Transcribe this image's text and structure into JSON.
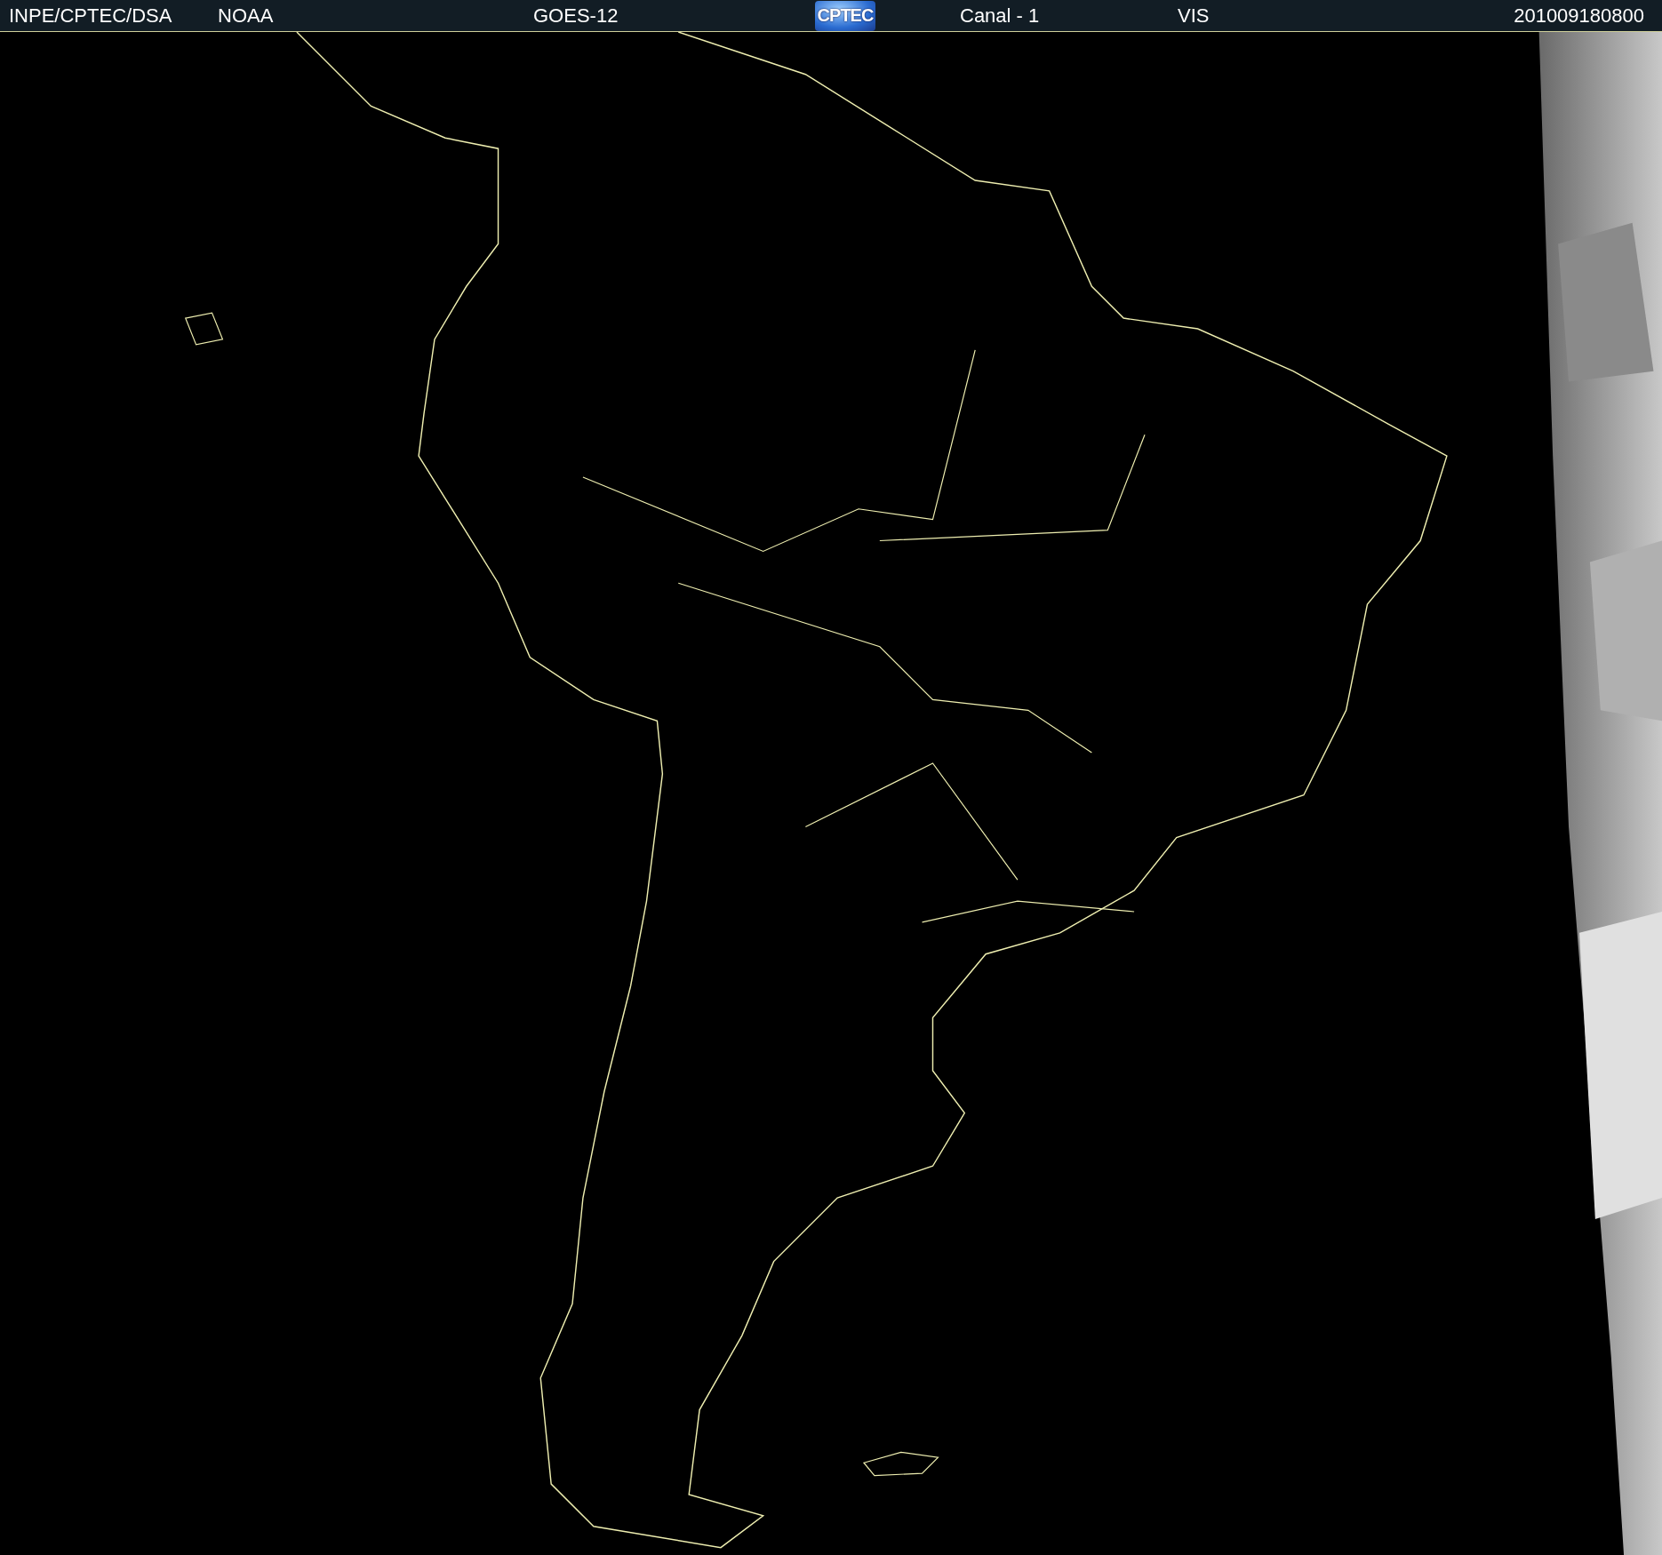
{
  "header": {
    "items": [
      "INPE/CPTEC/DSA",
      "NOAA",
      "GOES-12"
    ],
    "logo": "CPTEC",
    "items_right": [
      "Canal - 1",
      "VIS"
    ],
    "timestamp": "201009180800"
  }
}
